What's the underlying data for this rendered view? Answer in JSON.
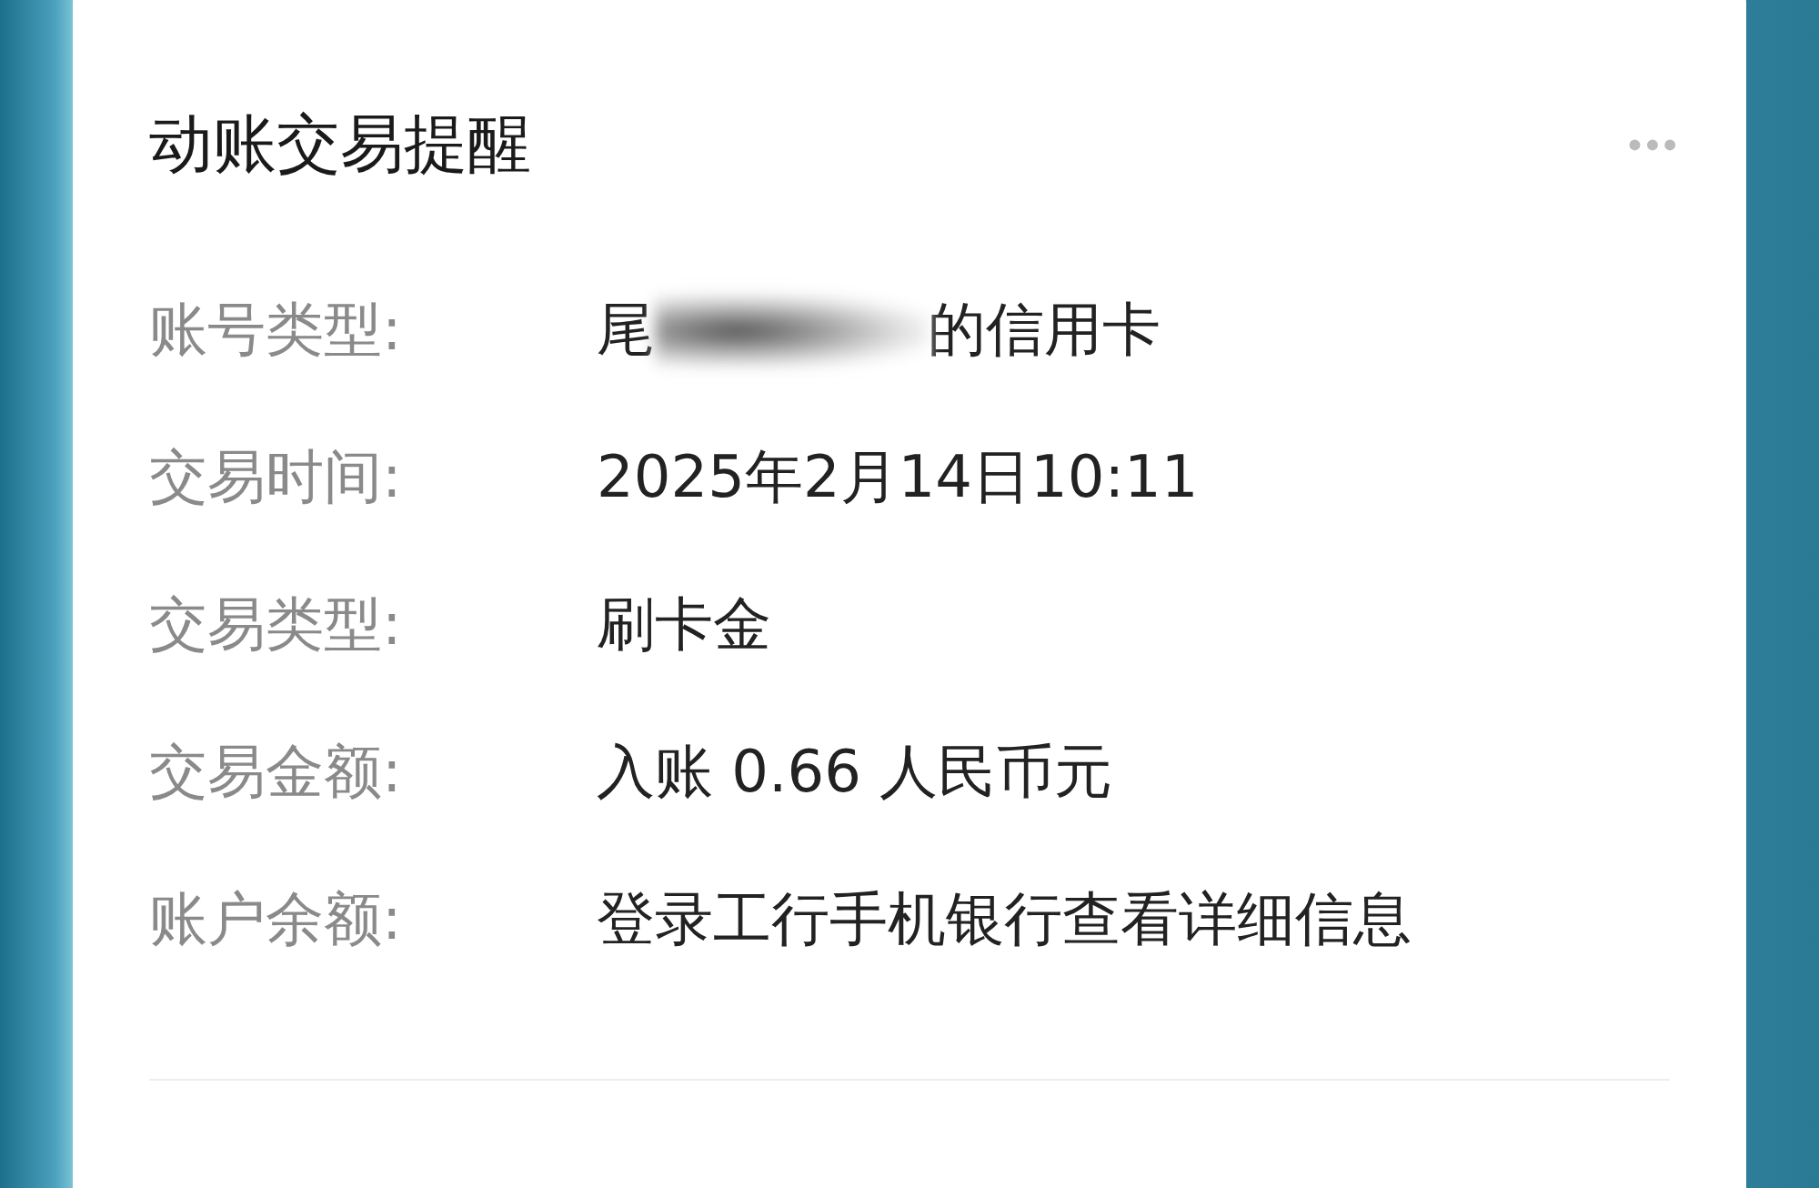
{
  "card": {
    "title": "动账交易提醒",
    "menu": "•••",
    "rows": [
      {
        "label": "账号类型:",
        "kind": "masked",
        "prefix": "尾",
        "suffix": "的信用卡"
      },
      {
        "label": "交易时间:",
        "kind": "text",
        "value": "2025年2月14日10:11"
      },
      {
        "label": "交易类型:",
        "kind": "text",
        "value": "刷卡金"
      },
      {
        "label": "交易金额:",
        "kind": "text",
        "value": "入账 0.66 人民币元"
      },
      {
        "label": "账户余额:",
        "kind": "text",
        "value": "登录工行手机银行查看详细信息"
      }
    ]
  }
}
